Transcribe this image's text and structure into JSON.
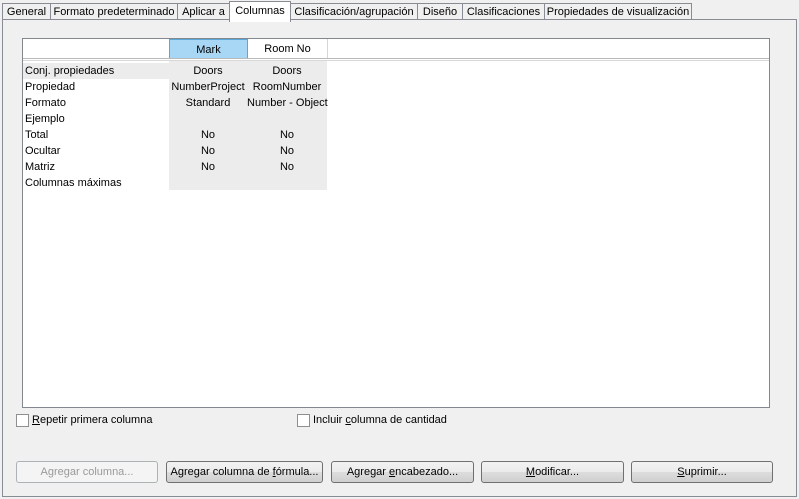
{
  "tabs": [
    {
      "label": "General"
    },
    {
      "label": "Formato predeterminado"
    },
    {
      "label": "Aplicar a"
    },
    {
      "label": "Columnas"
    },
    {
      "label": "Clasificación/agrupación"
    },
    {
      "label": "Diseño"
    },
    {
      "label": "Clasificaciones"
    },
    {
      "label": "Propiedades de visualización"
    }
  ],
  "grid": {
    "columns": [
      {
        "header": "Mark"
      },
      {
        "header": "Room No"
      }
    ],
    "row_labels": [
      "Conj. propiedades",
      "Propiedad",
      "Formato",
      "Ejemplo",
      "Total",
      "Ocultar",
      "Matriz",
      "Columnas máximas"
    ],
    "cells": [
      [
        "Doors",
        "Doors"
      ],
      [
        "NumberProject",
        "RoomNumber"
      ],
      [
        "Standard",
        "Number - Object"
      ],
      [
        "",
        ""
      ],
      [
        "No",
        "No"
      ],
      [
        "No",
        "No"
      ],
      [
        "No",
        "No"
      ],
      [
        "",
        ""
      ]
    ]
  },
  "checkboxes": {
    "repeat_first": {
      "label_u": "R",
      "label_rest": "epetir primera columna",
      "checked": false
    },
    "include_qty": {
      "label_a": "Incluir ",
      "label_u": "c",
      "label_b": "olumna de cantidad",
      "checked": false
    }
  },
  "buttons": {
    "add_column": "Agregar columna...",
    "add_formula_a": "Agregar columna de ",
    "add_formula_u": "f",
    "add_formula_b": "órmula...",
    "add_header_a": "Agregar ",
    "add_header_u": "e",
    "add_header_b": "ncabezado...",
    "modify_u": "M",
    "modify_b": "odificar...",
    "delete_u": "S",
    "delete_b": "uprimir..."
  }
}
